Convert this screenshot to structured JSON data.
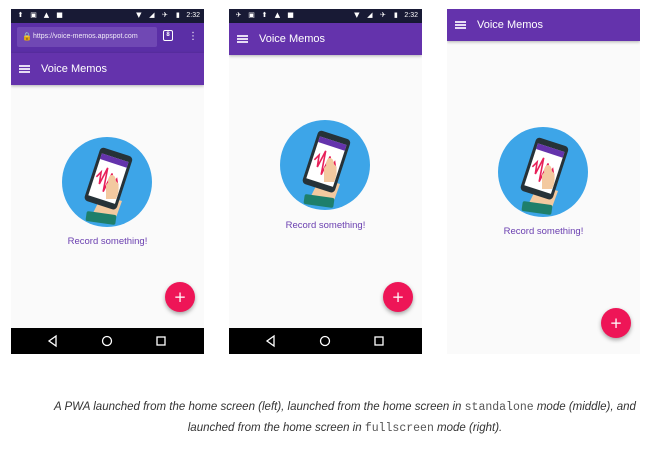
{
  "screens": [
    {
      "status": {
        "time": "2:32"
      },
      "browser": {
        "url": "https://voice-memos.appspot.com",
        "tab_count": "8"
      },
      "app": {
        "title": "Voice Memos",
        "record_label": "Record something!",
        "fab_label": "+"
      }
    },
    {
      "status": {
        "time": "2:32"
      },
      "app": {
        "title": "Voice Memos",
        "record_label": "Record something!",
        "fab_label": "+"
      }
    },
    {
      "app": {
        "title": "Voice Memos",
        "record_label": "Record something!",
        "fab_label": "+"
      }
    }
  ],
  "caption": {
    "part1": "A PWA launched from the home screen (left), launched from the home screen in ",
    "code1": "standalone",
    "part2": " mode (middle), and launched from the home screen in ",
    "code2": "fullscreen",
    "part3": " mode (right)."
  },
  "colors": {
    "status_bar": "#181a35",
    "browser_chrome": "#5b2fa6",
    "app_bar": "#6433ac",
    "accent_text": "#6a3fb0",
    "fab": "#ee1557",
    "illustration_circle": "#3da5e8"
  },
  "icons": [
    "upload-icon",
    "image-icon",
    "warning-icon",
    "app-icon",
    "wifi-icon",
    "signal-icon",
    "airplane-icon",
    "battery-icon",
    "lock-icon",
    "tabs-icon",
    "menu-icon",
    "back-icon",
    "home-icon",
    "recents-icon",
    "add-icon"
  ]
}
